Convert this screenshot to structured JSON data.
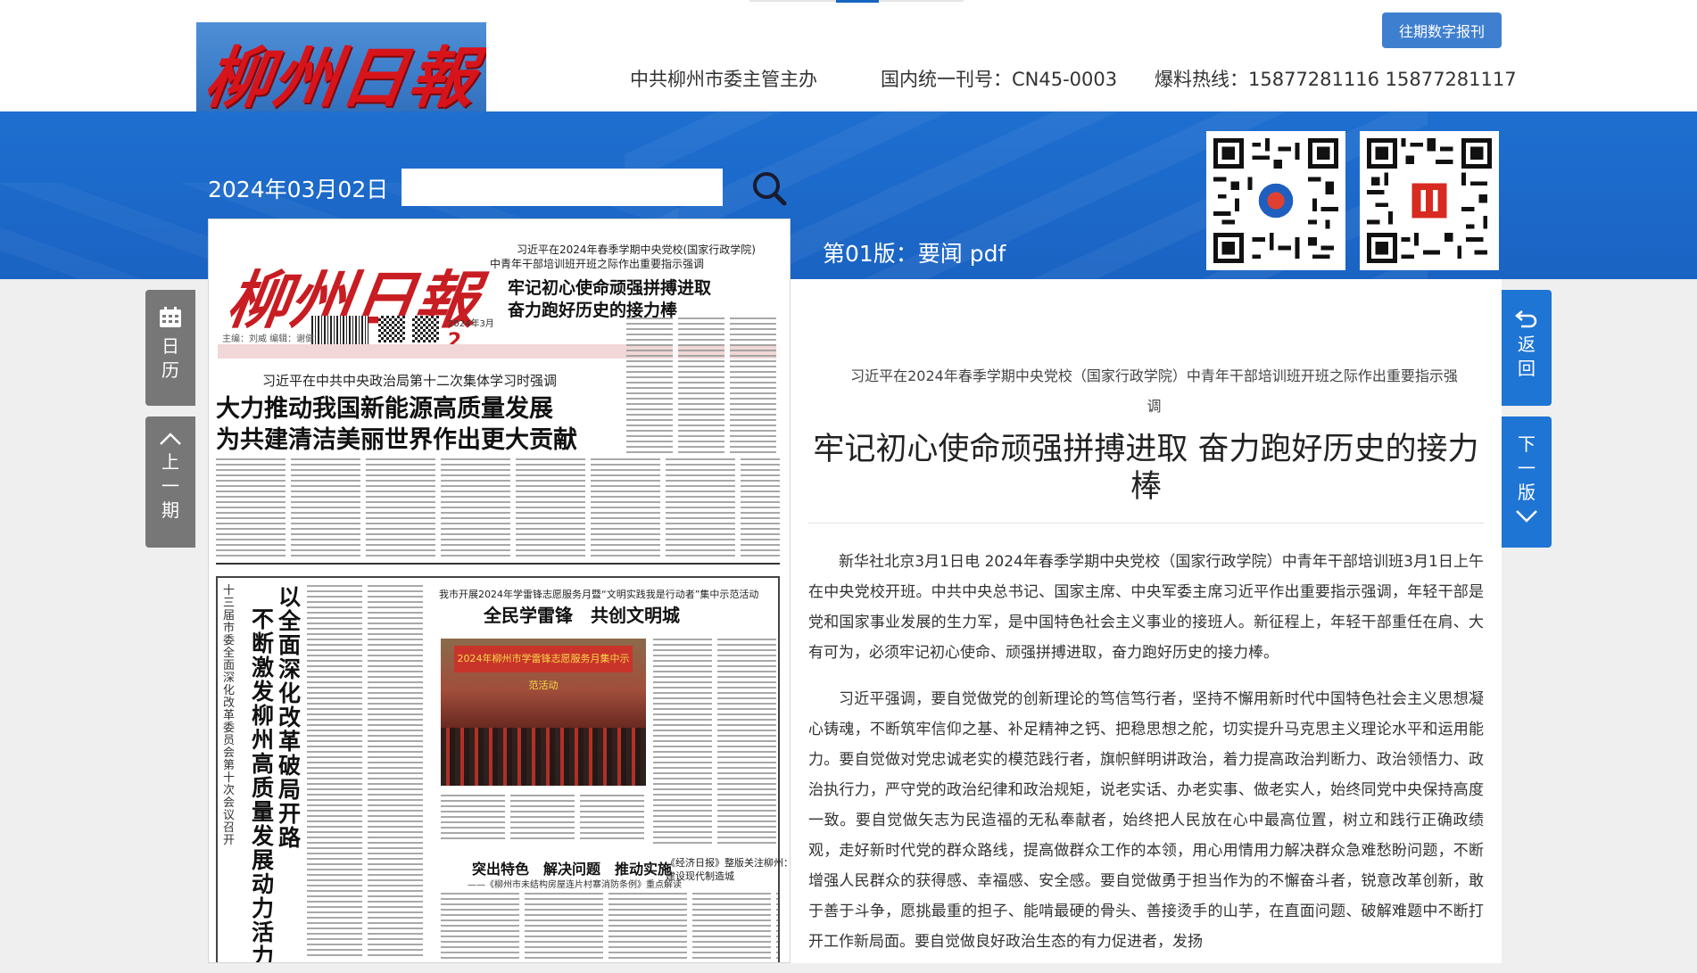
{
  "header": {
    "logo_text": "柳州日報",
    "digital_archive_button": "往期数字报刊",
    "sponsor": "中共柳州市委主管主办",
    "issn": "国内统一刊号：CN45-0003",
    "hotline": "爆料热线：15877281116 15877281117"
  },
  "band": {
    "date": "2024年03月02日",
    "date_input_value": "",
    "page_heading": "第01版：要闻 pdf"
  },
  "paper": {
    "logo": "柳州日報",
    "meta": "主编：刘威 编辑：谢健",
    "issue_number": "2024年3月",
    "page_number": "2",
    "kicker1": "习近平在2024年春季学期中央党校(国家行政学院)",
    "kicker2": "中青年干部培训班开班之际作出重要指示强调",
    "headline1": "牢记初心使命顽强拼搏进取",
    "headline2": "奋力跑好历史的接力棒",
    "h_kicker": "习近平在中共中央政治局第十二次集体学习时强调",
    "h_main1": "大力推动我国新能源高质量发展",
    "h_main2": "为共建清洁美丽世界作出更大贡献",
    "v_kicker": "十三届市委全面深化改革委员会第十次会议召开",
    "v_head1": "以全面深化改革破局开路",
    "v_head2": "不断激发柳州高质量发展动力活力",
    "feature_kicker": "我市开展2024年学雷锋志愿服务月暨“文明实践我是行动者”集中示范活动",
    "feature_head": "全民学雷锋　共创文明城",
    "photo_banner": "2024年柳州市学雷锋志愿服务月集中示范活动",
    "sub_head": "突出特色　解决问题　推动实施",
    "sub_kicker": "——《柳州市未结构房屋连片村寨消防条例》重点解读",
    "side_k1": "《经济日报》整版关注柳州：",
    "side_k2": "建设现代制造城"
  },
  "side_buttons": {
    "calendar": [
      "日",
      "历"
    ],
    "prev_issue": [
      "上",
      "一",
      "期"
    ],
    "back": [
      "返",
      "回"
    ],
    "next_page": [
      "下",
      "一",
      "版"
    ]
  },
  "article": {
    "kicker": "习近平在2024年春季学期中央党校（国家行政学院）中青年干部培训班开班之际作出重要指示强调",
    "title": "牢记初心使命顽强拼搏进取 奋力跑好历史的接力棒",
    "paragraphs": [
      "新华社北京3月1日电 2024年春季学期中央党校（国家行政学院）中青年干部培训班3月1日上午在中央党校开班。中共中央总书记、国家主席、中央军委主席习近平作出重要指示强调，年轻干部是党和国家事业发展的生力军，是中国特色社会主义事业的接班人。新征程上，年轻干部重任在肩、大有可为，必须牢记初心使命、顽强拼搏进取，奋力跑好历史的接力棒。",
      "习近平强调，要自觉做党的创新理论的笃信笃行者，坚持不懈用新时代中国特色社会主义思想凝心铸魂，不断筑牢信仰之基、补足精神之钙、把稳思想之舵，切实提升马克思主义理论水平和运用能力。要自觉做对党忠诚老实的模范践行者，旗帜鲜明讲政治，着力提高政治判断力、政治领悟力、政治执行力，严守党的政治纪律和政治规矩，说老实话、办老实事、做老实人，始终同党中央保持高度一致。要自觉做矢志为民造福的无私奉献者，始终把人民放在心中最高位置，树立和践行正确政绩观，走好新时代党的群众路线，提高做群众工作的本领，用心用情用力解决群众急难愁盼问题，不断增强人民群众的获得感、幸福感、安全感。要自觉做勇于担当作为的不懈奋斗者，锐意改革创新，敢于善于斗争，愿挑最重的担子、能啃最硬的骨头、善接烫手的山芋，在直面问题、破解难题中不断打开工作新局面。要自觉做良好政治生态的有力促进者，发扬"
    ]
  },
  "colors": {
    "brand_blue": "#1e6fd0",
    "button_blue": "#1f75d4",
    "side_gray": "#777777",
    "logo_red": "#d8141b"
  },
  "icons": {
    "search": "magnifier-icon",
    "calendar": "calendar-icon",
    "prev": "chevron-up-icon",
    "back": "return-arrow-icon",
    "next": "chevron-down-icon"
  }
}
